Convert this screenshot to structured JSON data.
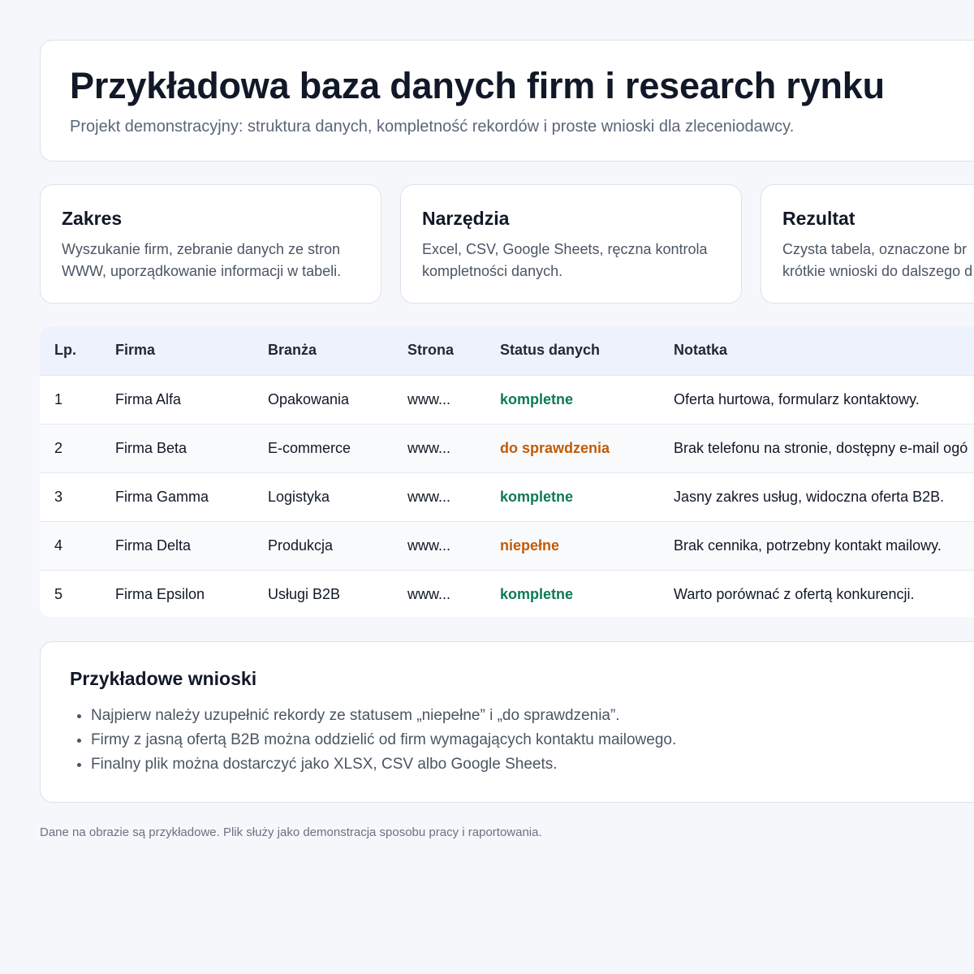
{
  "header": {
    "title": "Przykładowa baza danych firm i research rynku",
    "subtitle": "Projekt demonstracyjny: struktura danych, kompletność rekordów i proste wnioski dla zleceniodawcy."
  },
  "info_cards": [
    {
      "title": "Zakres",
      "lines": [
        "Wyszukanie firm, zebranie danych ze stron",
        "WWW, uporządkowanie informacji w tabeli."
      ]
    },
    {
      "title": "Narzędzia",
      "lines": [
        "Excel, CSV, Google Sheets, ręczna kontrola",
        "kompletności danych."
      ]
    },
    {
      "title": "Rezultat",
      "lines": [
        "Czysta tabela, oznaczone br",
        "krótkie wnioski do dalszego d"
      ]
    }
  ],
  "table": {
    "headers": [
      "Lp.",
      "Firma",
      "Branża",
      "Strona",
      "Status danych",
      "Notatka"
    ],
    "rows": [
      {
        "lp": "1",
        "firma": "Firma Alfa",
        "branza": "Opakowania",
        "strona": "www...",
        "status": "kompletne",
        "notatka": "Oferta hurtowa, formularz kontaktowy."
      },
      {
        "lp": "2",
        "firma": "Firma Beta",
        "branza": "E-commerce",
        "strona": "www...",
        "status": "do sprawdzenia",
        "notatka": "Brak telefonu na stronie, dostępny e-mail ogó"
      },
      {
        "lp": "3",
        "firma": "Firma Gamma",
        "branza": "Logistyka",
        "strona": "www...",
        "status": "kompletne",
        "notatka": "Jasny zakres usług, widoczna oferta B2B."
      },
      {
        "lp": "4",
        "firma": "Firma Delta",
        "branza": "Produkcja",
        "strona": "www...",
        "status": "niepełne",
        "notatka": "Brak cennika, potrzebny kontakt mailowy."
      },
      {
        "lp": "5",
        "firma": "Firma Epsilon",
        "branza": "Usługi B2B",
        "strona": "www...",
        "status": "kompletne",
        "notatka": "Warto porównać z ofertą konkurencji."
      }
    ]
  },
  "conclusions": {
    "title": "Przykładowe wnioski",
    "items": [
      "Najpierw należy uzupełnić rekordy ze statusem „niepełne” i „do sprawdzenia”.",
      "Firmy z jasną ofertą B2B można oddzielić od firm wymagających kontaktu mailowego.",
      "Finalny plik można dostarczyć jako XLSX, CSV albo Google Sheets."
    ]
  },
  "footer": {
    "note": "Dane na obrazie są przykładowe. Plik służy jako demonstracja sposobu pracy i raportowania."
  },
  "colors": {
    "status_complete": "#0d7a55",
    "status_warning": "#c25b06",
    "table_header_bg": "#eef2fd"
  }
}
